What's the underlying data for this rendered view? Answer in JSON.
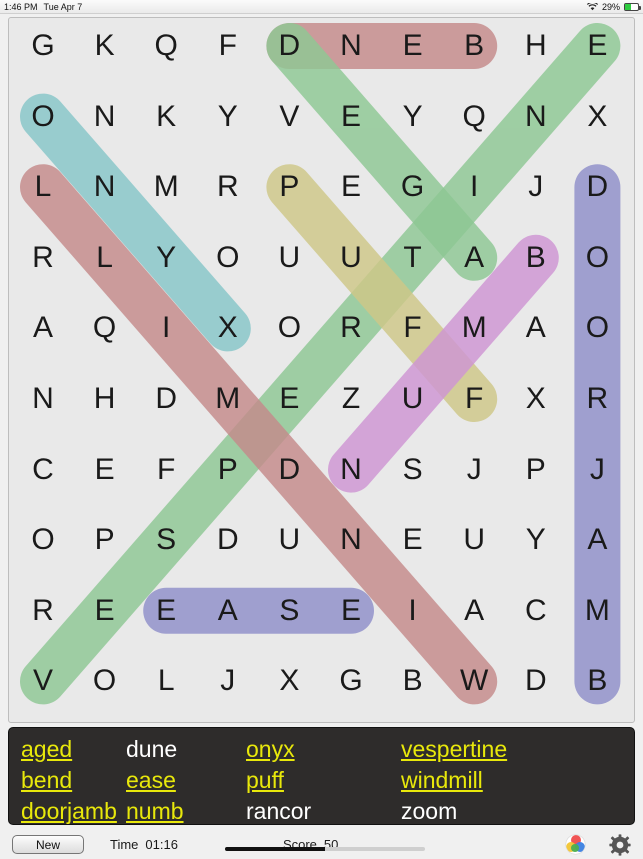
{
  "status_bar": {
    "time": "1:46 PM",
    "date": "Tue Apr 7",
    "wifi_icon": "wifi-icon",
    "battery_percent": "29%",
    "battery_icon": "battery-icon"
  },
  "grid": {
    "columns": 10,
    "rows": 10,
    "letters": [
      [
        "G",
        "K",
        "Q",
        "F",
        "D",
        "N",
        "E",
        "B",
        "H",
        "E"
      ],
      [
        "O",
        "N",
        "K",
        "Y",
        "V",
        "E",
        "Y",
        "Q",
        "N",
        "X"
      ],
      [
        "L",
        "N",
        "M",
        "R",
        "P",
        "E",
        "G",
        "I",
        "J",
        "D"
      ],
      [
        "R",
        "L",
        "Y",
        "O",
        "U",
        "U",
        "T",
        "A",
        "B",
        "O"
      ],
      [
        "A",
        "Q",
        "I",
        "X",
        "O",
        "R",
        "F",
        "M",
        "A",
        "O"
      ],
      [
        "N",
        "H",
        "D",
        "M",
        "E",
        "Z",
        "U",
        "F",
        "X",
        "R"
      ],
      [
        "C",
        "E",
        "F",
        "P",
        "D",
        "N",
        "S",
        "J",
        "P",
        "J"
      ],
      [
        "O",
        "P",
        "S",
        "D",
        "U",
        "N",
        "E",
        "U",
        "Y",
        "A"
      ],
      [
        "R",
        "E",
        "E",
        "A",
        "S",
        "E",
        "I",
        "A",
        "C",
        "M"
      ],
      [
        "V",
        "O",
        "L",
        "J",
        "X",
        "G",
        "B",
        "W",
        "D",
        "B"
      ]
    ],
    "highlights": [
      {
        "word": "bend",
        "color": "#c58b8b",
        "letters": "DNEB",
        "start": [
          0,
          4
        ],
        "end": [
          0,
          7
        ]
      },
      {
        "word": "aged",
        "color": "#8ec894",
        "letters": "DEGA",
        "start": [
          0,
          4
        ],
        "end": [
          3,
          7
        ]
      },
      {
        "word": "vespertine",
        "color": "#8ec894",
        "letters": "VESPERTINE",
        "start": [
          9,
          0
        ],
        "end": [
          0,
          9
        ]
      },
      {
        "word": "onyx",
        "color": "#87c6c9",
        "letters": "ONYX",
        "start": [
          1,
          0
        ],
        "end": [
          4,
          3
        ]
      },
      {
        "word": "windmill",
        "color": "#c58b8b",
        "letters": "LLIMDNIW",
        "start": [
          2,
          0
        ],
        "end": [
          9,
          7
        ]
      },
      {
        "word": "doorjamb",
        "color": "#8f8fca",
        "letters": "DOORJAMB",
        "start": [
          2,
          9
        ],
        "end": [
          9,
          9
        ]
      },
      {
        "word": "puff",
        "color": "#cfc888",
        "letters": "PUFF",
        "start": [
          2,
          4
        ],
        "end": [
          5,
          7
        ]
      },
      {
        "word": "numb",
        "color": "#cf96d4",
        "letters": "BMUN",
        "start": [
          3,
          8
        ],
        "end": [
          6,
          5
        ]
      },
      {
        "word": "ease",
        "color": "#8f8fca",
        "letters": "EASE",
        "start": [
          8,
          2
        ],
        "end": [
          8,
          5
        ]
      }
    ]
  },
  "word_list": {
    "rows": [
      [
        {
          "word": "aged",
          "found": true
        },
        {
          "word": "dune",
          "found": false
        },
        {
          "word": "onyx",
          "found": true
        },
        {
          "word": "vespertine",
          "found": true
        }
      ],
      [
        {
          "word": "bend",
          "found": true
        },
        {
          "word": "ease",
          "found": true
        },
        {
          "word": "puff",
          "found": true
        },
        {
          "word": "windmill",
          "found": true
        }
      ],
      [
        {
          "word": "doorjamb",
          "found": true
        },
        {
          "word": "numb",
          "found": true
        },
        {
          "word": "rancor",
          "found": false
        },
        {
          "word": "zoom",
          "found": false
        }
      ]
    ],
    "found_color": "#e8e80b",
    "pending_color": "#ffffff"
  },
  "bottom_bar": {
    "new_button": "New",
    "time_label": "Time",
    "time_value": "01:16",
    "score_label": "Score",
    "score_value": "50",
    "progress_percent": 50,
    "game_center_icon": "game-center-icon",
    "settings_icon": "gear-icon"
  }
}
